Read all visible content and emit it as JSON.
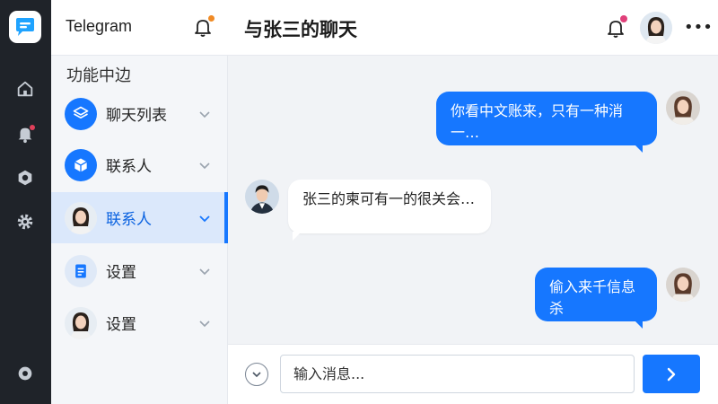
{
  "app": {
    "title": "Telegram",
    "accent": "#1677ff",
    "rail_icons": [
      "chat-logo-icon",
      "home-icon",
      "bell-icon",
      "contacts-icon",
      "settings-icon",
      "settings-icon"
    ]
  },
  "sidebar": {
    "section_title": "功能中边",
    "items": [
      {
        "label": "聊天列表",
        "icon": "box-icon",
        "active": false
      },
      {
        "label": "联系人",
        "icon": "cube-icon",
        "active": false
      },
      {
        "label": "联系人",
        "icon": "avatar",
        "active": true
      },
      {
        "label": "设置",
        "icon": "document-icon",
        "active": false
      },
      {
        "label": "设置",
        "icon": "avatar",
        "active": false
      }
    ]
  },
  "chat": {
    "title": "与张三的聊天",
    "messages": [
      {
        "direction": "out",
        "text": "你看中文账来，只有一种消一…"
      },
      {
        "direction": "in",
        "text": "张三的柬可有一的很关会…"
      },
      {
        "direction": "out",
        "text": "偷入来千信息杀"
      }
    ]
  },
  "composer": {
    "placeholder": "输入消息..."
  }
}
